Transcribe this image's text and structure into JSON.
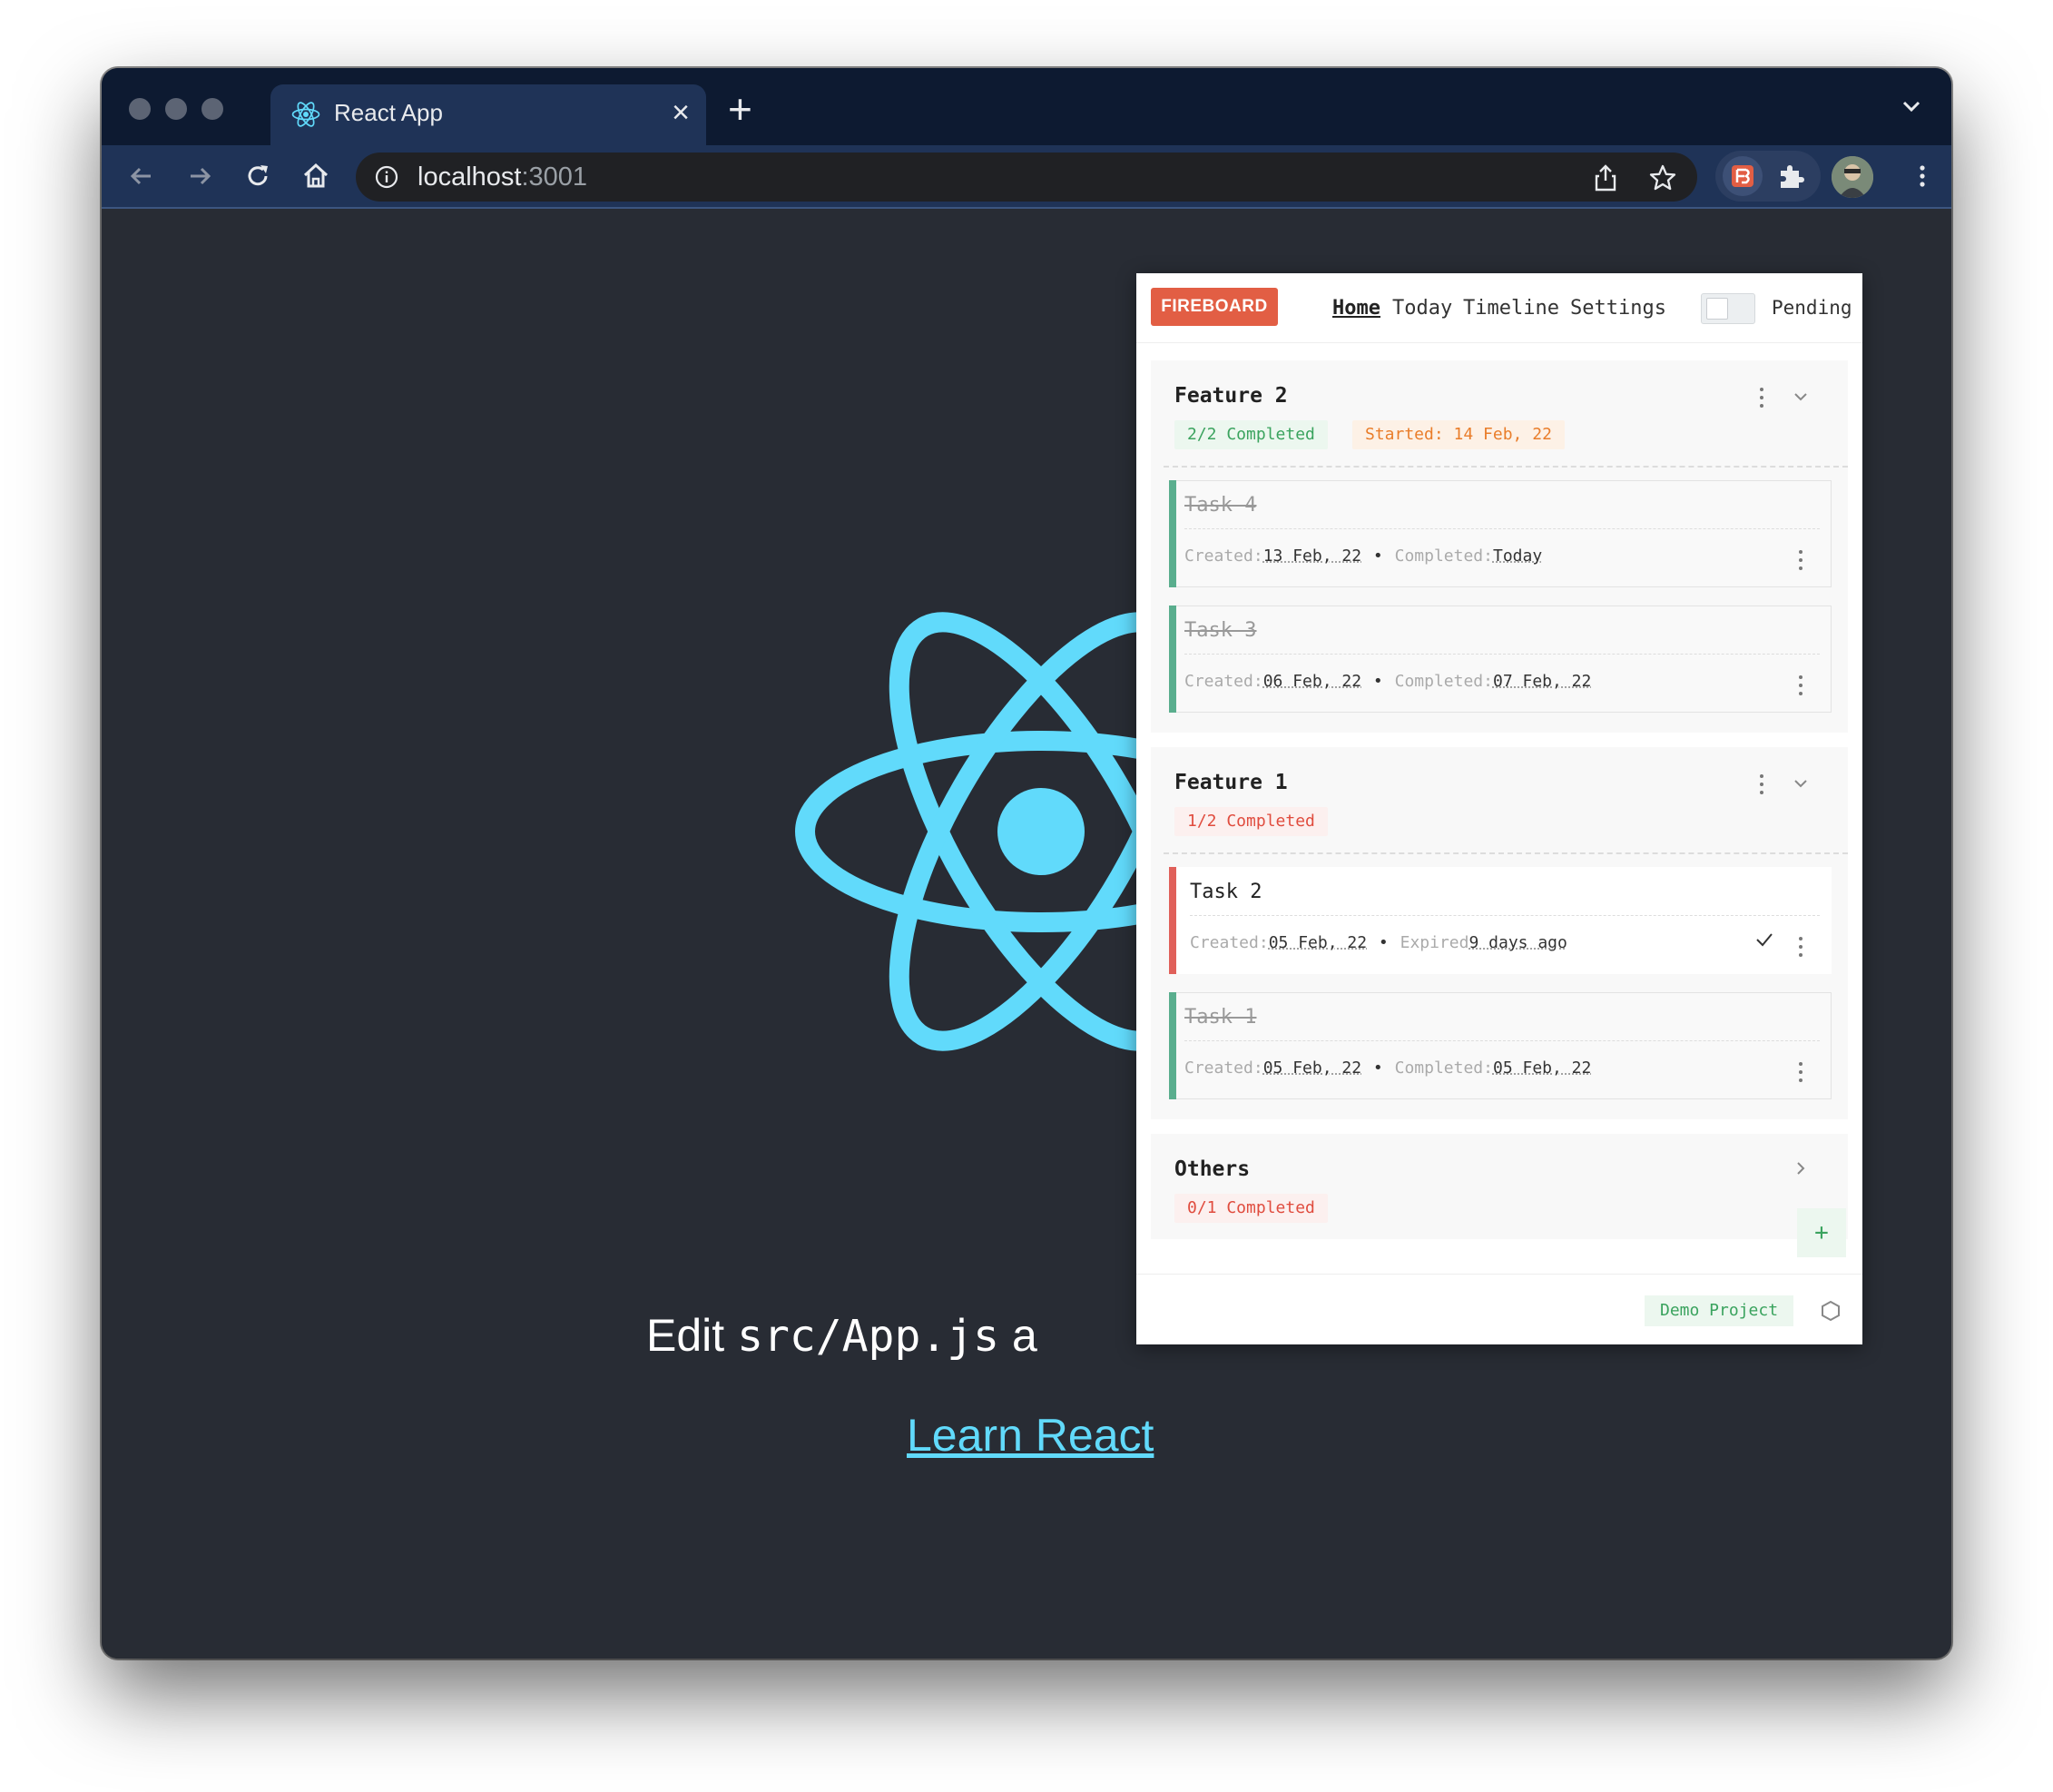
{
  "browser": {
    "tab_title": "React App",
    "url_host": "localhost",
    "url_port": ":3001"
  },
  "page": {
    "edit_prefix": "Edit ",
    "edit_code": "src/App.js",
    "edit_suffix": " a",
    "learn_link": "Learn React",
    "accent_color": "#61dafb"
  },
  "popup": {
    "brand": "FIREBOARD",
    "nav": [
      "Home",
      "Today",
      "Timeline",
      "Settings"
    ],
    "toggle_label": "Pending",
    "groups": [
      {
        "title": "Feature 2",
        "completed": "2/2 Completed",
        "started": "Started: 14 Feb, 22",
        "tasks": [
          {
            "name": "Task 4",
            "created_label": "Created:",
            "created": "13 Feb, 22",
            "status_label": "Completed:",
            "status": "Today"
          },
          {
            "name": "Task 3",
            "created_label": "Created:",
            "created": "06 Feb, 22",
            "status_label": "Completed:",
            "status": "07 Feb, 22"
          }
        ]
      },
      {
        "title": "Feature 1",
        "completed": "1/2 Completed",
        "tasks": [
          {
            "name": "Task 2",
            "created_label": "Created:",
            "created": "05 Feb, 22",
            "status_label": "Expired",
            "status": "9 days ago"
          },
          {
            "name": "Task 1",
            "created_label": "Created:",
            "created": "05 Feb, 22",
            "status_label": "Completed:",
            "status": "05 Feb, 22"
          }
        ]
      },
      {
        "title": "Others",
        "completed": "0/1 Completed"
      }
    ],
    "add_label": "+",
    "project_label": "Demo Project",
    "colors": {
      "brand": "#e25e44",
      "done": "#5aae8e",
      "expired": "#e0605a"
    }
  }
}
